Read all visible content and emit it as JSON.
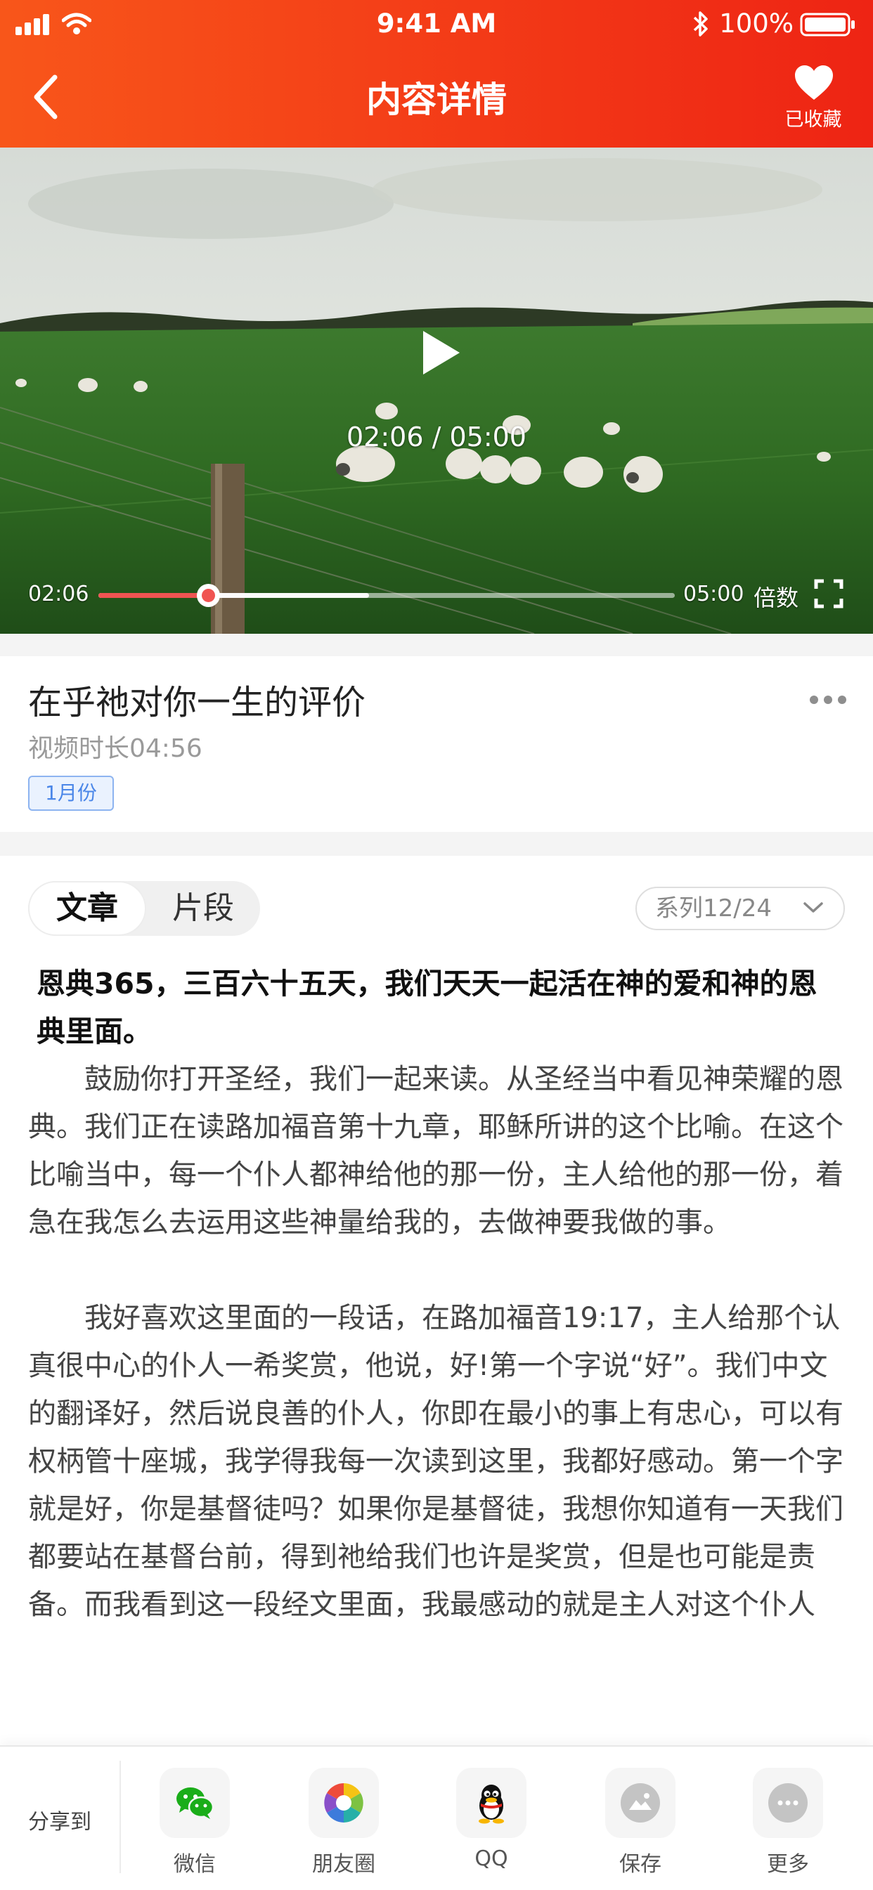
{
  "status_bar": {
    "time": "9:41 AM",
    "battery": "100%"
  },
  "nav": {
    "title": "内容详情",
    "favorite_label": "已收藏"
  },
  "video": {
    "center_time": "02:06 / 05:00",
    "current_time": "02:06",
    "total_time": "05:00",
    "speed_label": "倍数",
    "played_fraction": 0.19,
    "buffered_fraction": 0.47
  },
  "info": {
    "title": "在乎祂对你一生的评价",
    "duration": "视频时长04:56",
    "tag": "1月份"
  },
  "article": {
    "tabs": [
      "文章",
      "片段"
    ],
    "series": "系列12/24",
    "lead": "恩典365，三百六十五天，我们天天一起活在神的爱和神的恩典里面。",
    "paragraphs": [
      "鼓励你打开圣经，我们一起来读。从圣经当中看见神荣耀的恩典。我们正在读路加福音第十九章，耶稣所讲的这个比喻。在这个比喻当中，每一个仆人都神给他的那一份，主人给他的那一份，着急在我怎么去运用这些神量给我的，去做神要我做的事。",
      "我好喜欢这里面的一段话，在路加福音19:17，主人给那个认真很中心的仆人一希奖赏，他说，好!第一个字说“好”。我们中文的翻译好，然后说良善的仆人，你即在最小的事上有忠心，可以有权柄管十座城，我学得我每一次读到这里，我都好感动。第一个字就是好，你是基督徒吗？如果你是基督徒，我想你知道有一天我们都要站在基督台前，得到祂给我们也许是奖赏，但是也可能是责备。而我看到这一段经文里面，我最感动的就是主人对这个仆人"
    ]
  },
  "share": {
    "label": "分享到",
    "items": [
      {
        "label": "微信",
        "icon": "wechat-icon"
      },
      {
        "label": "朋友圈",
        "icon": "moments-icon"
      },
      {
        "label": "QQ",
        "icon": "qq-icon"
      },
      {
        "label": "保存",
        "icon": "save-icon"
      },
      {
        "label": "更多",
        "icon": "more-icon"
      }
    ]
  },
  "colors": {
    "accent": "#f33a17",
    "progress": "#f05452",
    "tag_blue": "#4a86e8"
  }
}
